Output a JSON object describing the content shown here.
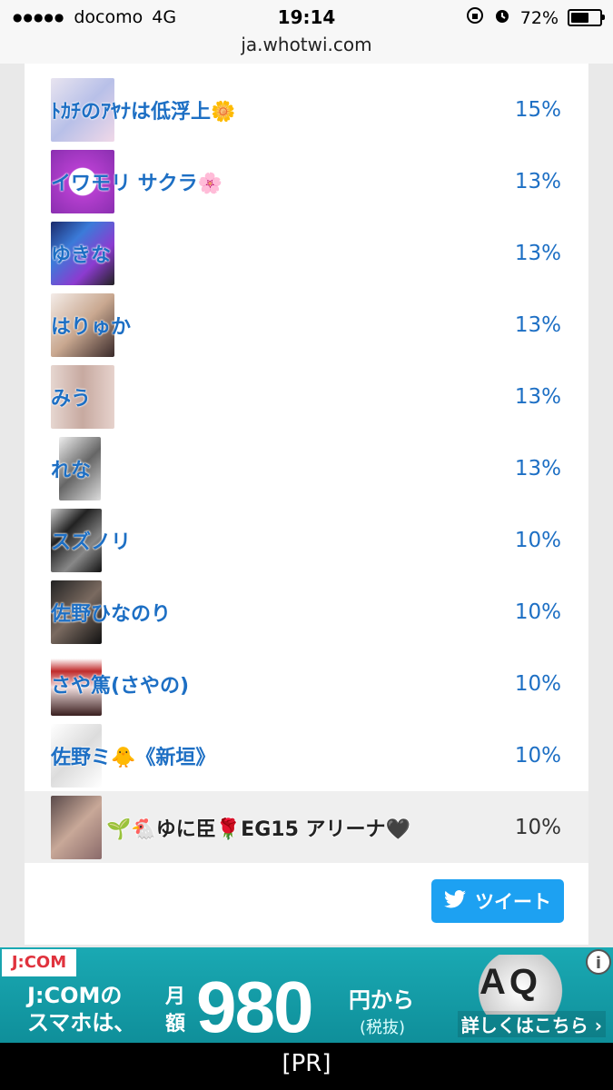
{
  "status_bar": {
    "signal_dots": "●●●●●",
    "carrier": "docomo",
    "network": "4G",
    "time": "19:14",
    "battery": "72%",
    "battery_level": 0.72
  },
  "url": "ja.whotwi.com",
  "rows": [
    {
      "name": "ﾄｶﾁのｱﾔﾅは低浮上🌼",
      "pct": "15%"
    },
    {
      "name": "イワモリ サクラ🌸",
      "pct": "13%"
    },
    {
      "name": "ゆきな",
      "pct": "13%"
    },
    {
      "name": "はりゅか",
      "pct": "13%"
    },
    {
      "name": "みう",
      "pct": "13%"
    },
    {
      "name": "れな",
      "pct": "13%"
    },
    {
      "name": "スズノリ",
      "pct": "10%"
    },
    {
      "name": "佐野ひなのり",
      "pct": "10%"
    },
    {
      "name": "さや篤(さやの)",
      "pct": "10%"
    },
    {
      "name": "佐野ミ🐥《新垣》",
      "pct": "10%"
    },
    {
      "name": "🌱🐔ゆに臣🌹EG15 アリーナ🖤",
      "pct": "10%"
    }
  ],
  "tweet_button": "ツイート",
  "ad": {
    "logo": "J:COM",
    "line1": "J:COMの",
    "line2": "スマホは、",
    "month": "月額",
    "price": "980",
    "from": "円から",
    "tax": "(税抜)",
    "more": "詳しくはこちら ›",
    "image_text": "AQ",
    "info": "i"
  },
  "pr_label": "[PR]",
  "colors": {
    "link": "#1d6fc4",
    "tweet": "#1da1f2",
    "ad_bg": "#14a0aa"
  }
}
